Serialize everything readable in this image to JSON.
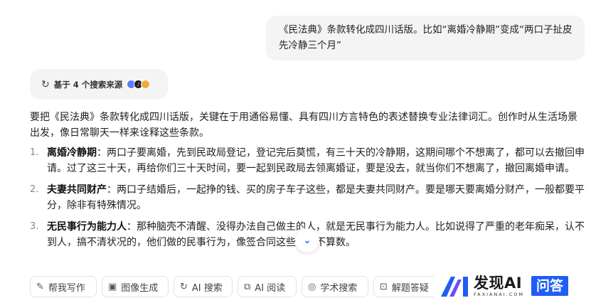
{
  "user_message": "《民法典》条款转化成四川话版。比如“离婚冷静期”变成“两口子扯皮先冷静三个月”",
  "sources": {
    "label": "基于 4 个搜索来源",
    "icon_colors": [
      "#5b7cfa",
      "#1a1a1a",
      "#f2a93b"
    ]
  },
  "answer": {
    "intro": "要把《民法典》条款转化成四川话版，关键在于用通俗易懂、具有四川方言特色的表述替换专业法律词汇。创作时从生活场景出发，像日常聊天一样来诠释这些条款。",
    "items": [
      {
        "num": "1.",
        "term": "离婚冷静期",
        "text": "：两口子要离婚，先到民政局登记，登记完后莫慌，有三十天的冷静期，这期间哪个不想离了，都可以去撤回申请。过了这三十天，再给你们三十天时间，要一起到民政局去领离婚证，要是没去，就当你们不想离了，撤回离婚申请。"
      },
      {
        "num": "2.",
        "term": "夫妻共同财产",
        "text": "：两口子结婚后，一起挣的钱、买的房子车子这些，都是夫妻共同财产。要是哪天要离婚分财产，一般都要平分，除非有特殊情况。"
      },
      {
        "num": "3.",
        "term": "无民事行为能力人",
        "text": "：那种脑壳不清醒、没得办法自己做主的人，就是无民事行为能力人。比如说得了严重的老年痴呆，认不到人，搞不清状况的，他们做的民事行为，像签合同这些，都不算数。"
      }
    ]
  },
  "toolbar": [
    {
      "icon": "pen-icon",
      "glyph": "✎",
      "label": "帮我写作"
    },
    {
      "icon": "image-icon",
      "glyph": "▣",
      "label": "图像生成"
    },
    {
      "icon": "search-icon",
      "glyph": "↻",
      "label": "AI 搜索"
    },
    {
      "icon": "read-icon",
      "glyph": "⧉",
      "label": "AI 阅读"
    },
    {
      "icon": "academic-icon",
      "glyph": "◎",
      "label": "学术搜索"
    },
    {
      "icon": "solve-icon",
      "glyph": "⊡",
      "label": "解题答疑"
    }
  ],
  "watermark": {
    "name": "发现AI",
    "url": "FAXIANAI.COM",
    "badge": "问答"
  }
}
